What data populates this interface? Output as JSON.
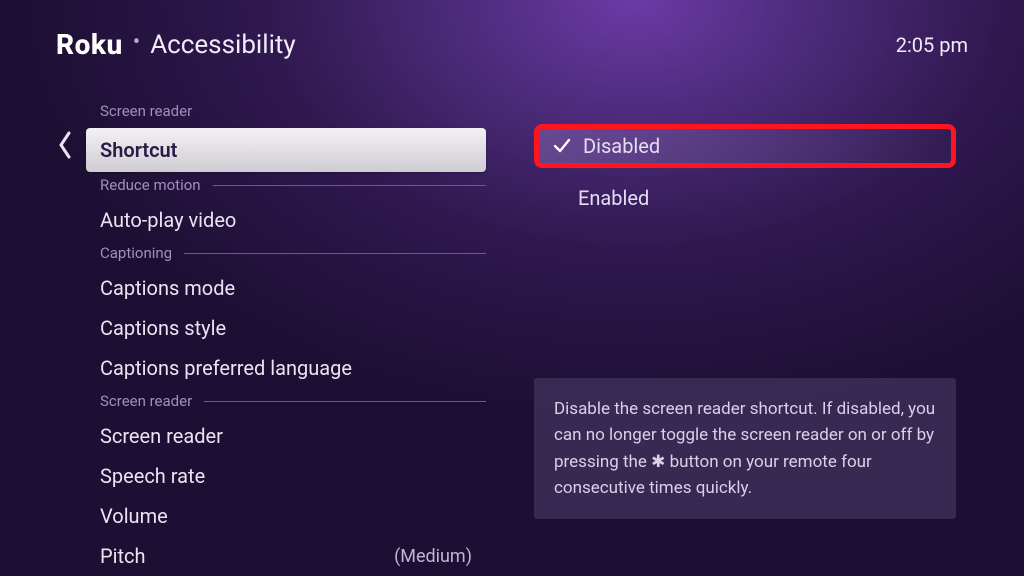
{
  "brand": "Roku",
  "breadcrumb": "Accessibility",
  "clock": "2:05 pm",
  "left": {
    "top_label": "Screen reader",
    "selected": "Shortcut",
    "groups": [
      {
        "label": "Reduce motion",
        "items": [
          {
            "label": "Auto-play video",
            "value": ""
          }
        ]
      },
      {
        "label": "Captioning",
        "items": [
          {
            "label": "Captions mode",
            "value": ""
          },
          {
            "label": "Captions style",
            "value": ""
          },
          {
            "label": "Captions preferred language",
            "value": ""
          }
        ]
      },
      {
        "label": "Screen reader",
        "items": [
          {
            "label": "Screen reader",
            "value": ""
          },
          {
            "label": "Speech rate",
            "value": ""
          },
          {
            "label": "Volume",
            "value": ""
          },
          {
            "label": "Pitch",
            "value": "(Medium)"
          }
        ]
      }
    ]
  },
  "right": {
    "options": [
      {
        "label": "Disabled",
        "checked": true
      },
      {
        "label": "Enabled",
        "checked": false
      }
    ]
  },
  "help": {
    "pre": "Disable the screen reader shortcut. If disabled, you can no longer toggle the screen reader on or off by pressing the ",
    "star": "✱",
    "post": " button on your remote four consecutive times quickly."
  }
}
